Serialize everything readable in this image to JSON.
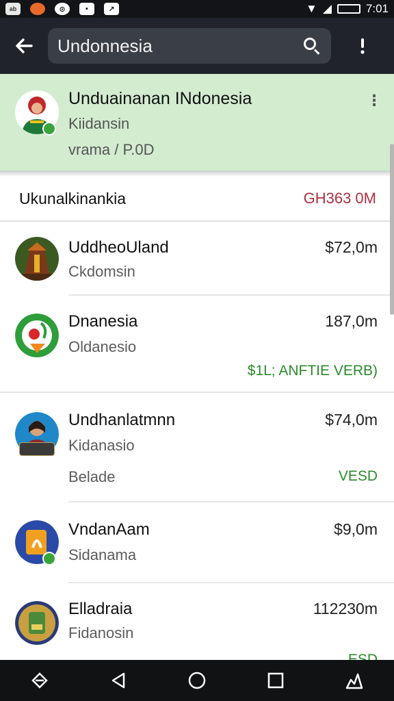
{
  "status_bar": {
    "time": "7:01",
    "left_icons": [
      "app-icon-1",
      "app-icon-2",
      "app-icon-3",
      "app-icon-4",
      "app-icon-5"
    ],
    "right_icons": [
      "wifi-icon",
      "signal-icon",
      "battery-icon"
    ]
  },
  "app_bar": {
    "search_value": "Undonnesia",
    "back_icon": "arrow-left-icon",
    "search_icon": "search-icon",
    "more_icon": "more-vert-icon"
  },
  "highlight_card": {
    "title": "Unduainanan INdonesia",
    "subtitle": "Kiidansin",
    "detail": "vrama / P.0D",
    "menu_glyph": "⋮"
  },
  "summary": {
    "label": "Ukunalkinankia",
    "value": "GH363 0M"
  },
  "items": [
    {
      "name": "UddheoUland",
      "sub": "Ckdomsin",
      "amount": "$72,0m",
      "sub2": "",
      "tag": ""
    },
    {
      "name": "Dnanesia",
      "sub": "Oldanesio",
      "amount": "187,0m",
      "sub2": "",
      "tag": "$1L; ANFTIE VERB)"
    },
    {
      "name": "Undhanlatmnn",
      "sub": "Kidanasio",
      "amount": "$74,0m",
      "sub2": "Belade",
      "tag": "VESD"
    },
    {
      "name": "VndanAam",
      "sub": "Sidanama",
      "amount": "$9,0m",
      "sub2": "",
      "tag": ""
    },
    {
      "name": "Elladraia",
      "sub": "Fidanosin",
      "amount": "112230m",
      "sub2": "",
      "tag": "ESD"
    }
  ],
  "nav_bar": {
    "icons": [
      "rotate-icon",
      "back-triangle-icon",
      "home-circle-icon",
      "recents-square-icon",
      "assist-icon"
    ]
  },
  "colors": {
    "highlight_bg": "#d3ecd0",
    "app_bar_bg": "#20242a",
    "positive_tag": "#2a8a2a",
    "summary_value": "#b03040"
  }
}
